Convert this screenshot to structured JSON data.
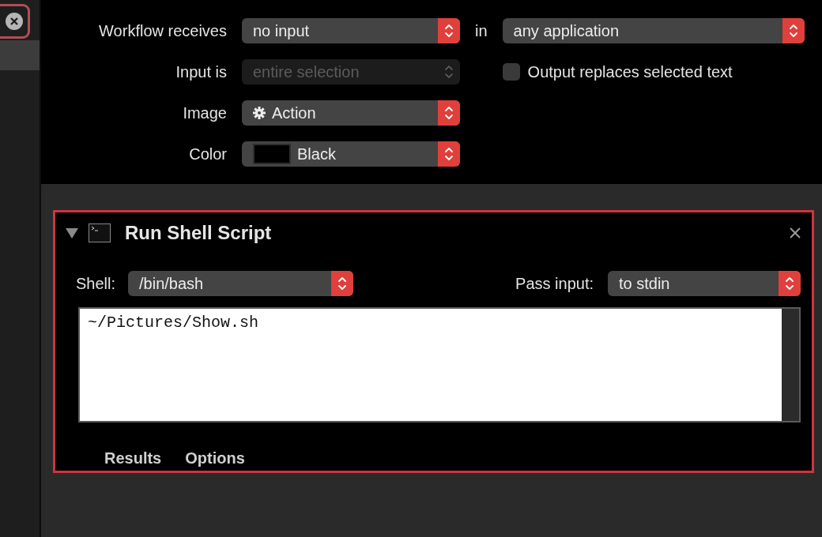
{
  "workflow": {
    "receives": {
      "label": "Workflow receives",
      "value": "no input",
      "disabled": false
    },
    "in": {
      "label": "in",
      "value": "any application",
      "disabled": false
    },
    "input_is": {
      "label": "Input is",
      "value": "entire selection",
      "disabled": true
    },
    "output_replaces": {
      "label": "Output replaces selected text",
      "checked": false
    },
    "image": {
      "label": "Image",
      "value": "Action",
      "disabled": false
    },
    "color": {
      "label": "Color",
      "value": "Black",
      "disabled": false
    }
  },
  "action": {
    "title": "Run Shell Script",
    "expanded": true,
    "shell": {
      "label": "Shell:",
      "value": "/bin/bash",
      "disabled": false
    },
    "pass_input": {
      "label": "Pass input:",
      "value": "to stdin",
      "disabled": false
    },
    "script": "~/Pictures/Show.sh",
    "tabs": [
      {
        "label": "Results",
        "selected": false
      },
      {
        "label": "Options",
        "selected": false
      }
    ]
  }
}
